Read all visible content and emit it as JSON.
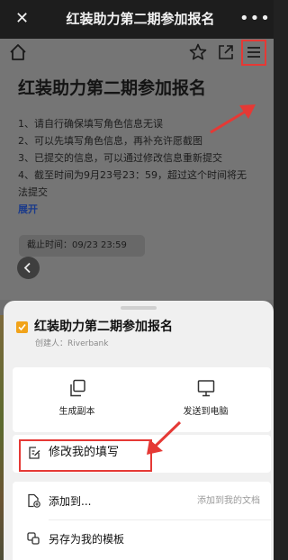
{
  "titlebar": {
    "title": "红装助力第二期参加报名",
    "close_icon": "close-icon",
    "more_icon": "more-dots-icon"
  },
  "doc": {
    "toolbar_icons": [
      "home-icon",
      "star-icon",
      "share-icon",
      "menu-icon"
    ],
    "title": "红装助力第二期参加报名",
    "lines": [
      "1、请自行确保填写角色信息无误",
      "2、可以先填写角色信息，再补充许愿截图",
      "3、已提交的信息，可以通过修改信息重新提交",
      "4、截至时间为9月23号23：59，超过这个时间将无",
      "法提交"
    ],
    "expand_label": "展开",
    "deadline": "截止时间：09/23 23:59",
    "back_icon": "chevron-left-icon"
  },
  "sheet": {
    "doc_title": "红装助力第二期参加报名",
    "creator": "创建人：Riverbank",
    "actions": [
      {
        "label": "生成副本",
        "icon": "copy-icon"
      },
      {
        "label": "发送到电脑",
        "icon": "monitor-icon"
      }
    ],
    "modify_label": "修改我的填写",
    "modify_icon": "edit-form-icon",
    "rows": [
      {
        "label": "添加到...",
        "hint": "添加到我的文档",
        "icon": "add-doc-icon"
      },
      {
        "label": "另存为我的模板",
        "hint": "",
        "icon": "template-icon"
      }
    ]
  },
  "colors": {
    "highlight": "#e53935",
    "checkbox": "#f1a31a",
    "link": "#1a3a8a"
  }
}
